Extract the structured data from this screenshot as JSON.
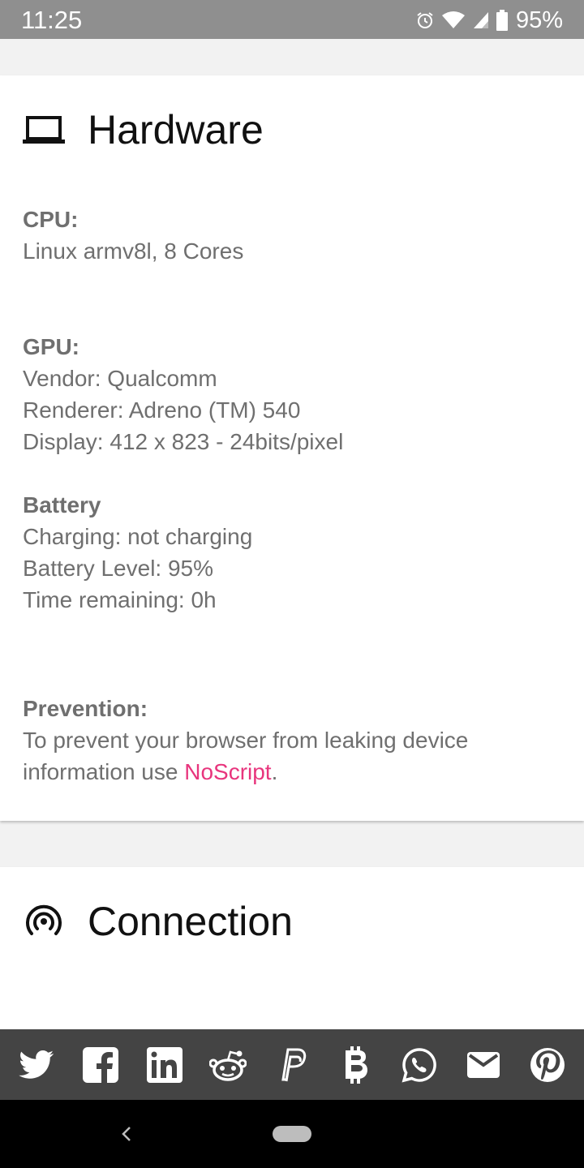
{
  "status_bar": {
    "time": "11:25",
    "battery_percent": "95%",
    "icons": [
      "alarm-icon",
      "wifi-icon",
      "cell-signal-icon",
      "battery-icon"
    ]
  },
  "hardware": {
    "title": "Hardware",
    "icon": "laptop-icon",
    "cpu": {
      "label": "CPU:",
      "lines": [
        "Linux armv8l, 8 Cores"
      ]
    },
    "gpu": {
      "label": "GPU:",
      "lines": [
        "Vendor: Qualcomm",
        "Renderer: Adreno (TM) 540",
        "Display: 412 x 823 - 24bits/pixel"
      ]
    },
    "battery": {
      "label": "Battery",
      "lines": [
        "Charging: not charging",
        "Battery Level: 95%",
        "Time remaining: 0h"
      ]
    },
    "prevention": {
      "label": "Prevention:",
      "text_before": "To prevent your browser from leaking device information use ",
      "link_text": "NoScript",
      "text_after": "."
    }
  },
  "connection": {
    "title": "Connection",
    "icon": "connection-icon"
  },
  "share_bar": {
    "items": [
      "twitter-icon",
      "facebook-icon",
      "linkedin-icon",
      "reddit-icon",
      "paypal-icon",
      "bitcoin-icon",
      "whatsapp-icon",
      "email-icon",
      "pinterest-icon"
    ]
  },
  "colors": {
    "link": "#e8357d",
    "status_bar": "#8f8f8f",
    "share_bar": "#444444"
  }
}
